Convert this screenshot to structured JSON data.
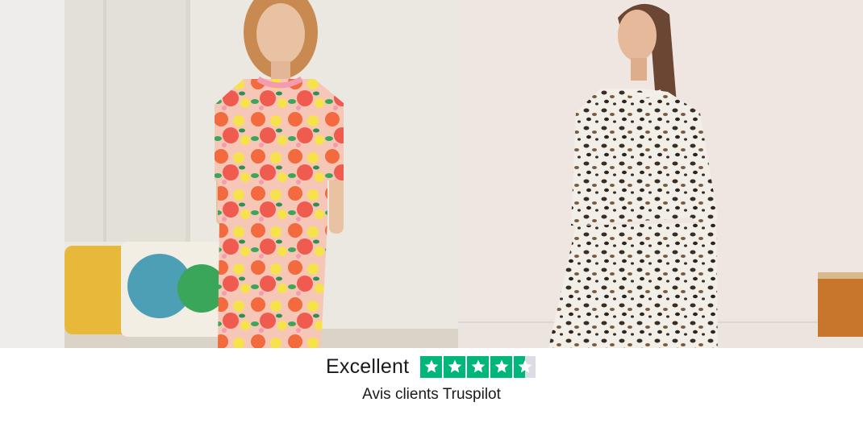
{
  "hero": {
    "left_photo_alt": "Pyjama fleuri",
    "right_photo_alt": "Pyjama léopard"
  },
  "reviews": {
    "rating_word": "Excellent",
    "caption": "Avis clients Truspilot",
    "stars_total": 5,
    "stars_value": 4.5,
    "star_color": "#00b67a",
    "star_empty_color": "#dcdce6",
    "star_icon": "trustpilot-star-icon"
  }
}
